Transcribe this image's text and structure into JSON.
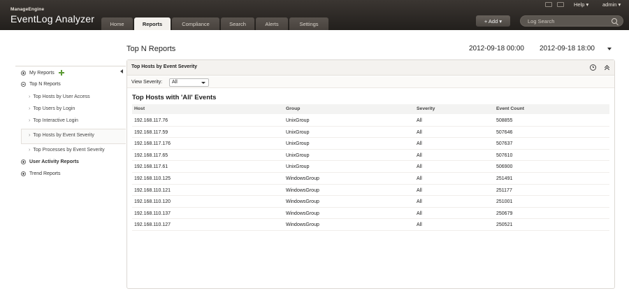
{
  "header": {
    "brand_small": "ManageEngine",
    "brand_name": "EventLog Analyzer",
    "tabs": [
      {
        "label": "Home"
      },
      {
        "label": "Reports"
      },
      {
        "label": "Compliance"
      },
      {
        "label": "Search"
      },
      {
        "label": "Alerts"
      },
      {
        "label": "Settings"
      }
    ],
    "active_tab": "Reports",
    "help_label": "Help",
    "user_label": "admin",
    "add_label": "+ Add",
    "search_placeholder": "Log Search"
  },
  "page": {
    "title": "Top N Reports",
    "date_from": "2012-09-18 00:00",
    "date_to": "2012-09-18 18:00"
  },
  "sidebar": {
    "items": [
      {
        "label": "My Reports"
      },
      {
        "label": "Top N Reports"
      },
      {
        "label": "User Activity Reports"
      },
      {
        "label": "Trend Reports"
      }
    ],
    "sub_items": [
      {
        "label": "Top Hosts by User Access"
      },
      {
        "label": "Top Users by Login"
      },
      {
        "label": "Top Interactive Login"
      },
      {
        "label": "Top Hosts by Event Severity"
      },
      {
        "label": "Top Processes by Event Severity"
      }
    ],
    "selected_sub_item": "Top Hosts by Event Severity"
  },
  "panel": {
    "title": "Top Hosts by Event Severity",
    "filter_label": "View Severity:",
    "filter_value": "All",
    "report_title": "Top Hosts with 'All' Events",
    "columns": [
      "Host",
      "Group",
      "Severity",
      "Event Count"
    ],
    "rows": [
      {
        "host": "192.168.117.76",
        "group": "UnixGroup",
        "severity": "All",
        "count": "508855"
      },
      {
        "host": "192.168.117.59",
        "group": "UnixGroup",
        "severity": "All",
        "count": "507646"
      },
      {
        "host": "192.168.117.176",
        "group": "UnixGroup",
        "severity": "All",
        "count": "507637"
      },
      {
        "host": "192.168.117.65",
        "group": "UnixGroup",
        "severity": "All",
        "count": "507610"
      },
      {
        "host": "192.168.117.61",
        "group": "UnixGroup",
        "severity": "All",
        "count": "506900"
      },
      {
        "host": "192.168.110.125",
        "group": "WindowsGroup",
        "severity": "All",
        "count": "251491"
      },
      {
        "host": "192.168.110.121",
        "group": "WindowsGroup",
        "severity": "All",
        "count": "251177"
      },
      {
        "host": "192.168.110.120",
        "group": "WindowsGroup",
        "severity": "All",
        "count": "251001"
      },
      {
        "host": "192.168.110.137",
        "group": "WindowsGroup",
        "severity": "All",
        "count": "250679"
      },
      {
        "host": "192.168.110.127",
        "group": "WindowsGroup",
        "severity": "All",
        "count": "250521"
      }
    ]
  },
  "icons": {
    "header_left": "monitor-icon",
    "header_right": "window-icon",
    "schedule": "clock-icon",
    "collapse": "chevron-up-icon",
    "search": "search-icon",
    "add_report": "plus-icon"
  },
  "colors": {
    "header_bg": "#2b2724",
    "active_tab_bg": "#f3f0ec",
    "add_icon": "#5c9a36"
  }
}
